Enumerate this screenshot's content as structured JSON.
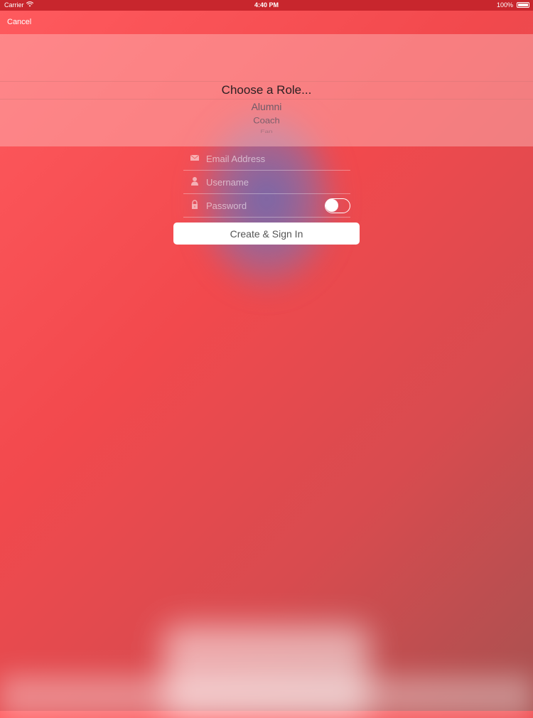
{
  "status_bar": {
    "carrier": "Carrier",
    "time": "4:40 PM",
    "battery": "100%"
  },
  "nav": {
    "cancel_label": "Cancel"
  },
  "picker": {
    "selected": "Choose a Role...",
    "options": [
      "Alumni",
      "Coach",
      "Fan"
    ]
  },
  "form": {
    "email_placeholder": "Email Address",
    "username_placeholder": "Username",
    "password_placeholder": "Password",
    "submit_label": "Create & Sign In"
  },
  "colors": {
    "background": "#f2494d",
    "status_bar": "#c8262d",
    "button_bg": "#ffffff"
  }
}
